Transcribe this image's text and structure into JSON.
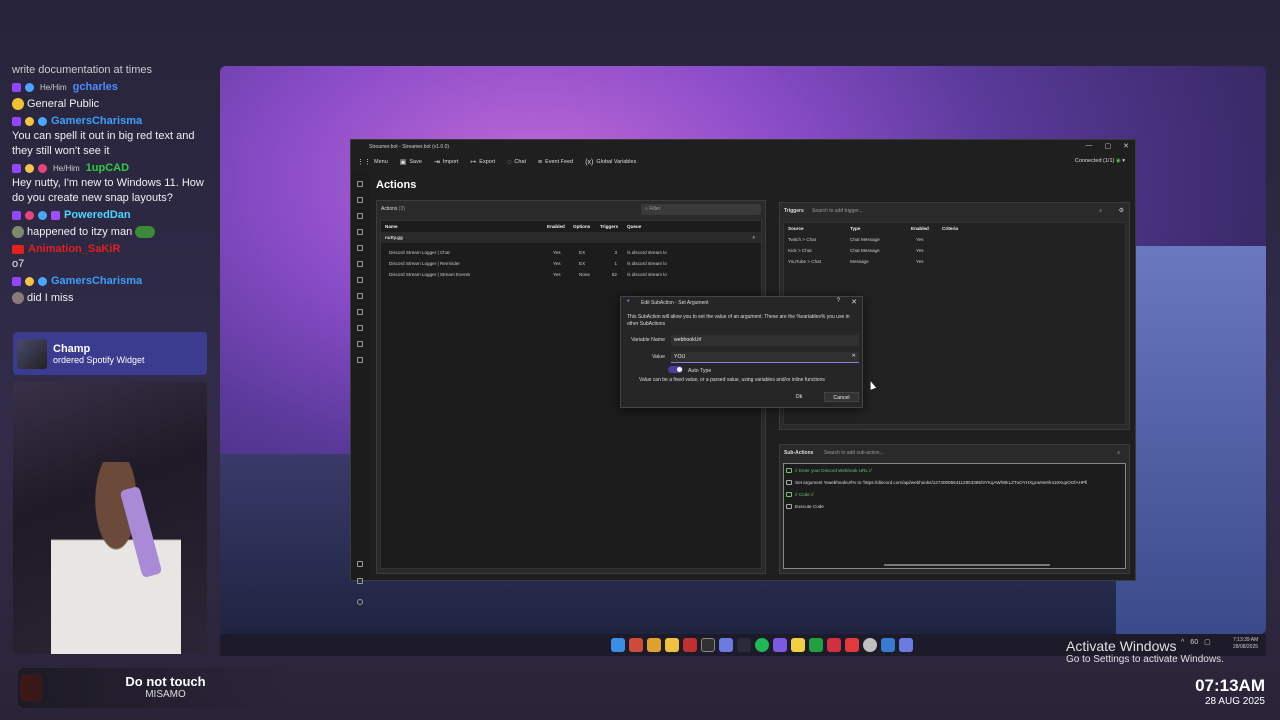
{
  "chat": {
    "partial_top": "write documentation at times",
    "messages": [
      {
        "pronoun": "He/Him",
        "user": "gcharles",
        "user_color": "#4a8cff",
        "text": ""
      },
      {
        "pronoun": "",
        "user": "",
        "user_color": "",
        "text": "General Public"
      },
      {
        "pronoun": "",
        "user": "GamersCharisma",
        "user_color": "#3aa0ff",
        "text": "You can spell it out in big red text and they still won't see it"
      },
      {
        "pronoun": "He/Him",
        "user": "1upCAD",
        "user_color": "#2ecc40",
        "text": "Hey nutty, I'm new to Windows 11. How do you create new snap layouts?"
      },
      {
        "pronoun": "",
        "user": "PoweredDan",
        "user_color": "#4ad6ff",
        "text": "happened to itzy man"
      },
      {
        "pronoun": "",
        "user": "Animation_SaKiR",
        "user_color": "#e02020",
        "text": "o7"
      },
      {
        "pronoun": "",
        "user": "GamersCharisma",
        "user_color": "#3aa0ff",
        "text": "did I miss"
      }
    ]
  },
  "notification": {
    "title": "Champ",
    "subtitle": "ordered Spotify Widget"
  },
  "now_playing": {
    "title": "Do not touch",
    "artist": "MISAMO"
  },
  "overlay_clock": {
    "time": "07:13AM",
    "date": "28 AUG 2025"
  },
  "activate": {
    "line1": "Activate Windows",
    "line2": "Go to Settings to activate Windows."
  },
  "tray": {
    "volume": "60",
    "time": "7:13:39 AM",
    "date": "28/08/2025"
  },
  "app": {
    "title": "Streamer.bot - Streamer.bot (v1.0.0)",
    "menu": [
      {
        "label": "Menu",
        "icon": "grid-icon"
      },
      {
        "label": "Save",
        "icon": "save-icon"
      },
      {
        "label": "Import",
        "icon": "import-icon"
      },
      {
        "label": "Export",
        "icon": "export-icon"
      },
      {
        "label": "Chat",
        "icon": "chat-icon"
      },
      {
        "label": "Event Feed",
        "icon": "feed-icon"
      },
      {
        "label": "Global Variables",
        "icon": "variables-icon"
      }
    ],
    "connection": "Connected (1/1)",
    "page_title": "Actions",
    "actions": {
      "header": "Actions",
      "count": "(3)",
      "filter_placeholder": "Filter",
      "columns": [
        "Name",
        "Enabled",
        "Options",
        "Triggers",
        "Queue"
      ],
      "group": "nutty.gg",
      "rows": [
        [
          "Discord Stream Logger | Chat",
          "Yes",
          "EX",
          "3",
          "/s discord stream lo"
        ],
        [
          "Discord Stream Logger | Reminder",
          "Yes",
          "EX",
          "1",
          "/s discord stream lo"
        ],
        [
          "Discord Stream Logger | Stream Events",
          "Yes",
          "None",
          "52",
          "/s discord stream lo"
        ]
      ]
    },
    "triggers": {
      "header": "Triggers",
      "search_placeholder": "Search to add trigger...",
      "columns": [
        "Source",
        "Type",
        "Enabled",
        "Criteria"
      ],
      "rows": [
        [
          "Twitch > Chat",
          "Chat Message",
          "Yes",
          ""
        ],
        [
          "Kick > Chat",
          "Chat Message",
          "Yes",
          ""
        ],
        [
          "YouTube > Chat",
          "Message",
          "Yes",
          ""
        ]
      ]
    },
    "subactions": {
      "header": "Sub-Actions",
      "search_placeholder": "Search to add sub-action...",
      "items": [
        {
          "text": "// Enter your Discord Webhook URL //",
          "comment": true
        },
        {
          "text": "Set argument %webhookUrl% to 'https://discord.com/api/webhooks/1274008564112953385/9YKqAWhBkLZTuOYHXgcwNe9h419XupOGfAHPfi",
          "comment": false
        },
        {
          "text": "// Code //",
          "comment": true
        },
        {
          "text": "Execute Code",
          "comment": false
        }
      ]
    }
  },
  "dialog": {
    "title": "Edit SubAction - Set Argument",
    "description": "This SubAction will allow you to set the value of an argument.  These are the %variables% you use in other SubActions",
    "variable_label": "Variable Name",
    "variable_value": "webhookUrl",
    "value_label": "Value",
    "value_value": "YOU",
    "auto_type_label": "Auto Type",
    "auto_type_on": true,
    "hint": "Value can be a fixed value, or a parsed value, using variables and/or inline functions",
    "ok_label": "Ok",
    "cancel_label": "Cancel",
    "help_glyph": "?",
    "close_glyph": "✕"
  }
}
